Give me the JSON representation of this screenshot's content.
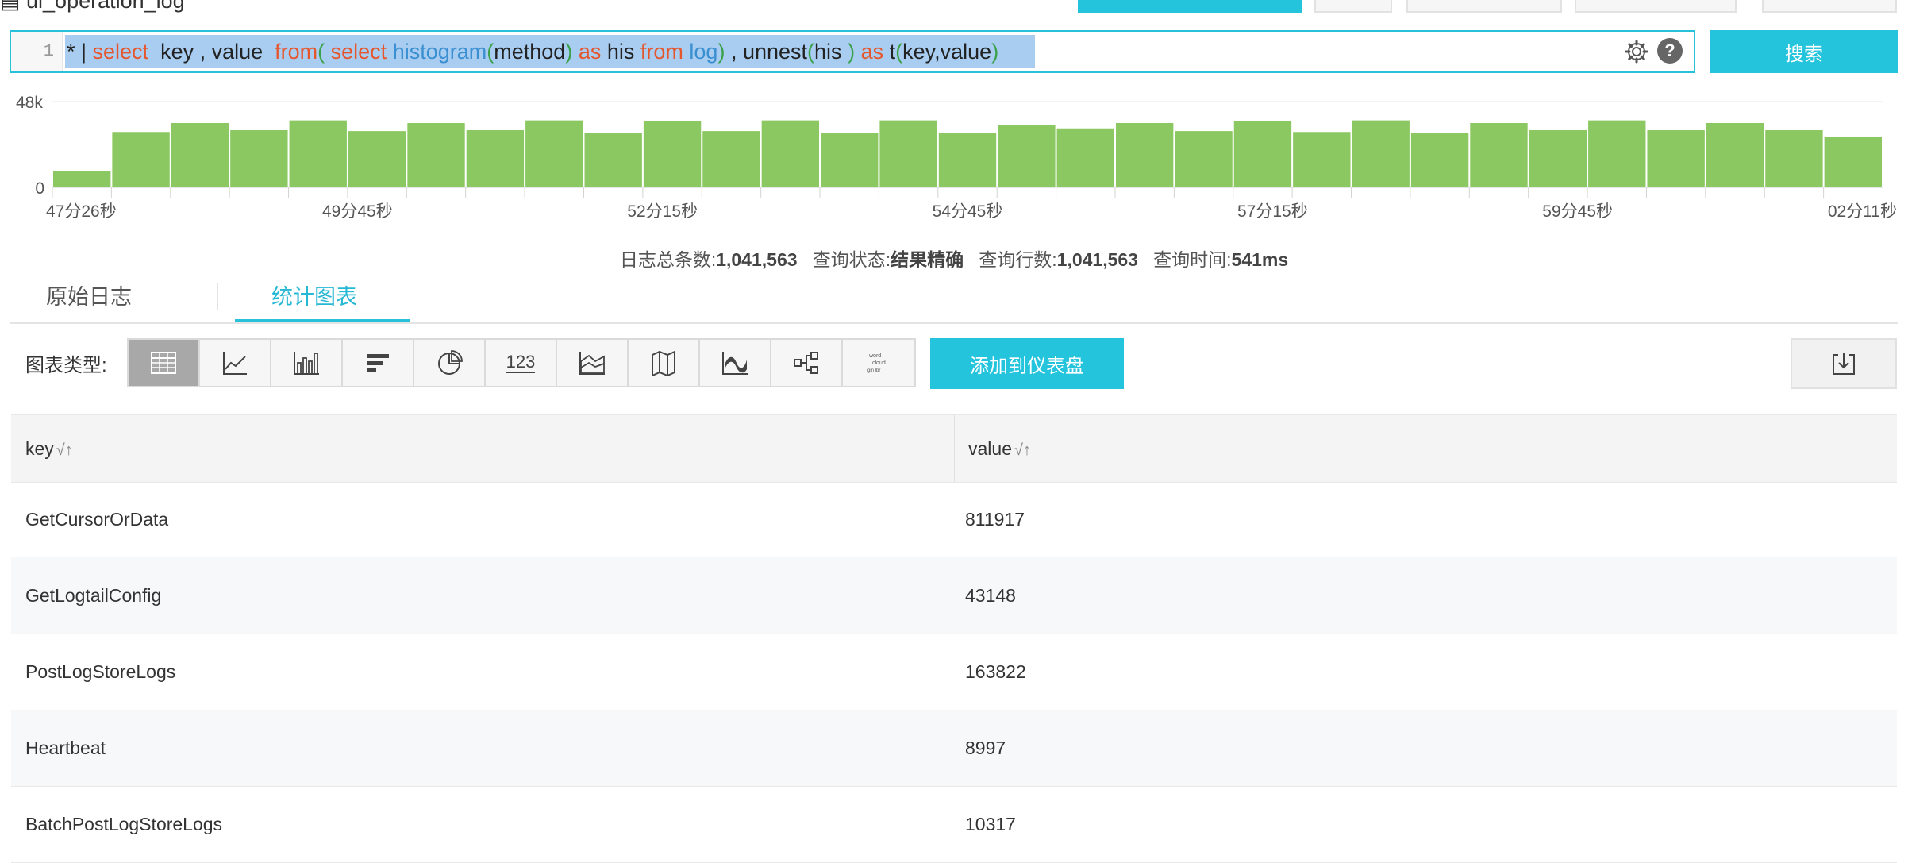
{
  "header": {
    "title": "ui_operation_log"
  },
  "query": {
    "line_number": "1",
    "tokens": [
      {
        "t": "* ",
        "c": "plain"
      },
      {
        "t": "| ",
        "c": "plain"
      },
      {
        "t": "select",
        "c": "kw"
      },
      {
        "t": "  key , value  ",
        "c": "plain"
      },
      {
        "t": "from",
        "c": "kw"
      },
      {
        "t": "( ",
        "c": "br"
      },
      {
        "t": "select",
        "c": "kw"
      },
      {
        "t": " ",
        "c": "plain"
      },
      {
        "t": "histogram",
        "c": "fn"
      },
      {
        "t": "(",
        "c": "br"
      },
      {
        "t": "method",
        "c": "plain"
      },
      {
        "t": ")",
        "c": "br"
      },
      {
        "t": " ",
        "c": "plain"
      },
      {
        "t": "as",
        "c": "kw"
      },
      {
        "t": " his ",
        "c": "plain"
      },
      {
        "t": "from",
        "c": "kw"
      },
      {
        "t": " ",
        "c": "plain"
      },
      {
        "t": "log",
        "c": "fn"
      },
      {
        "t": ")",
        "c": "br"
      },
      {
        "t": " , unnest",
        "c": "plain"
      },
      {
        "t": "(",
        "c": "br"
      },
      {
        "t": "his ",
        "c": "plain"
      },
      {
        "t": ")",
        "c": "br"
      },
      {
        "t": " ",
        "c": "plain"
      },
      {
        "t": "as",
        "c": "kw"
      },
      {
        "t": " t",
        "c": "plain"
      },
      {
        "t": "(",
        "c": "br"
      },
      {
        "t": "key,value",
        "c": "plain"
      },
      {
        "t": ")",
        "c": "br"
      }
    ],
    "settings_icon": "gear-icon",
    "help_label": "?",
    "search_label": "搜索"
  },
  "histogram": {
    "y_ticks": [
      "48k",
      "0"
    ],
    "x_labels": [
      "47分26秒",
      "49分45秒",
      "52分15秒",
      "54分45秒",
      "57分15秒",
      "59分45秒",
      "02分11秒"
    ],
    "bar_color": "#8cc862",
    "values": [
      9000,
      31000,
      36000,
      32000,
      37500,
      31500,
      36000,
      32000,
      37500,
      30500,
      37000,
      31500,
      37500,
      30500,
      37500,
      30500,
      35000,
      33000,
      36000,
      31500,
      37000,
      31000,
      37500,
      30500,
      36000,
      32000,
      37500,
      32000,
      36000,
      32000,
      28000
    ],
    "y_max": 48000
  },
  "summary": {
    "total_label": "日志总条数:",
    "total_value": "1,041,563",
    "status_label": "查询状态:",
    "status_value": "结果精确",
    "rows_label": "查询行数:",
    "rows_value": "1,041,563",
    "time_label": "查询时间:",
    "time_value": "541ms"
  },
  "tabs": [
    {
      "label": "原始日志",
      "active": false
    },
    {
      "label": "统计图表",
      "active": true
    }
  ],
  "chart_types": {
    "label": "图表类型:",
    "items": [
      "table-icon",
      "line-chart-icon",
      "bar-chart-icon",
      "horizontal-bar-icon",
      "pie-chart-icon",
      "number-icon",
      "area-chart-icon",
      "map-icon",
      "flow-chart-icon",
      "topology-icon",
      "word-cloud-icon"
    ],
    "number_text": "123",
    "add_dashboard_label": "添加到仪表盘",
    "download_icon": "download-icon"
  },
  "table": {
    "columns": [
      "key",
      "value"
    ],
    "sort_icon": "√↑",
    "rows": [
      {
        "key": "GetCursorOrData",
        "value": "811917"
      },
      {
        "key": "GetLogtailConfig",
        "value": "43148"
      },
      {
        "key": "PostLogStoreLogs",
        "value": "163822"
      },
      {
        "key": "Heartbeat",
        "value": "8997"
      },
      {
        "key": "BatchPostLogStoreLogs",
        "value": "10317"
      }
    ]
  },
  "colors": {
    "accent": "#25c4dd",
    "bar": "#8cc862",
    "keyword": "#e6562d",
    "function": "#3a8fd1"
  }
}
